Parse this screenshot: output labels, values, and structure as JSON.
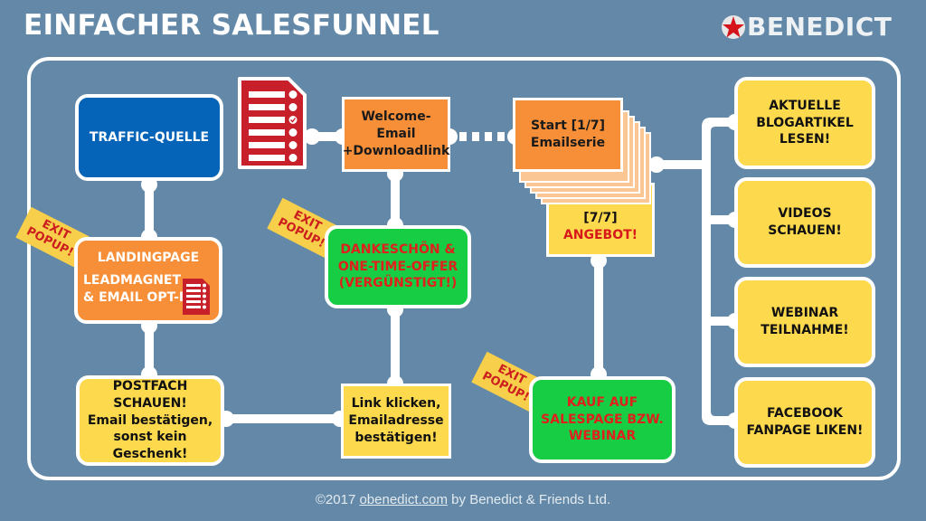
{
  "header": {
    "title": "EINFACHER SALESFUNNEL",
    "logo_text": "BENEDICT",
    "logo_icon": "star-badge-icon"
  },
  "colors": {
    "background": "#6489a8",
    "blue": "#0564b8",
    "orange": "#f68f38",
    "yellow": "#fdd94d",
    "green": "#16cd43",
    "red_text": "#d7191c",
    "doc_red": "#c8202a"
  },
  "nodes": {
    "traffic": "TRAFFIC-QUELLE",
    "landing_title": "LANDINGPAGE",
    "landing_line1": "LEADMAGNET",
    "landing_line2": "& EMAIL OPT-IN",
    "postfach_line1": "POSTFACH SCHAUEN!",
    "postfach_line2": "Email bestätigen,",
    "postfach_line3": "sonst kein Geschenk!",
    "welcome_line1": "Welcome-",
    "welcome_line2": "Email",
    "welcome_line3": "+Downloadlink",
    "dankeschoen_line1": "DANKESCHÖN &",
    "dankeschoen_line2": "ONE-TIME-OFFER",
    "dankeschoen_line3": "(VERGÜNSTIGT!)",
    "link_line1": "Link klicken,",
    "link_line2": "Emailadresse",
    "link_line3": "bestätigen!",
    "series_line1": "Start [1/7]",
    "series_line2": "Emailserie",
    "offer_line1": "[7/7]",
    "offer_line2": "ANGEBOT!",
    "kauf_line1": "KAUF AUF",
    "kauf_line2": "SALESPAGE BZW.",
    "kauf_line3": "WEBINAR",
    "blog_line1": "AKTUELLE",
    "blog_line2": "BLOGARTIKEL",
    "blog_line3": "LESEN!",
    "videos_line1": "VIDEOS",
    "videos_line2": "SCHAUEN!",
    "webinar_line1": "WEBINAR",
    "webinar_line2": "TEILNAHME!",
    "facebook_line1": "FACEBOOK",
    "facebook_line2": "FANPAGE LIKEN!"
  },
  "tags": {
    "exit_line1": "EXIT",
    "exit_line2": "POPUP!"
  },
  "icons": {
    "document": "checklist-document-icon"
  },
  "footer": {
    "prefix": "©2017 ",
    "link": "obenedict.com",
    "suffix": " by Benedict & Friends Ltd."
  }
}
